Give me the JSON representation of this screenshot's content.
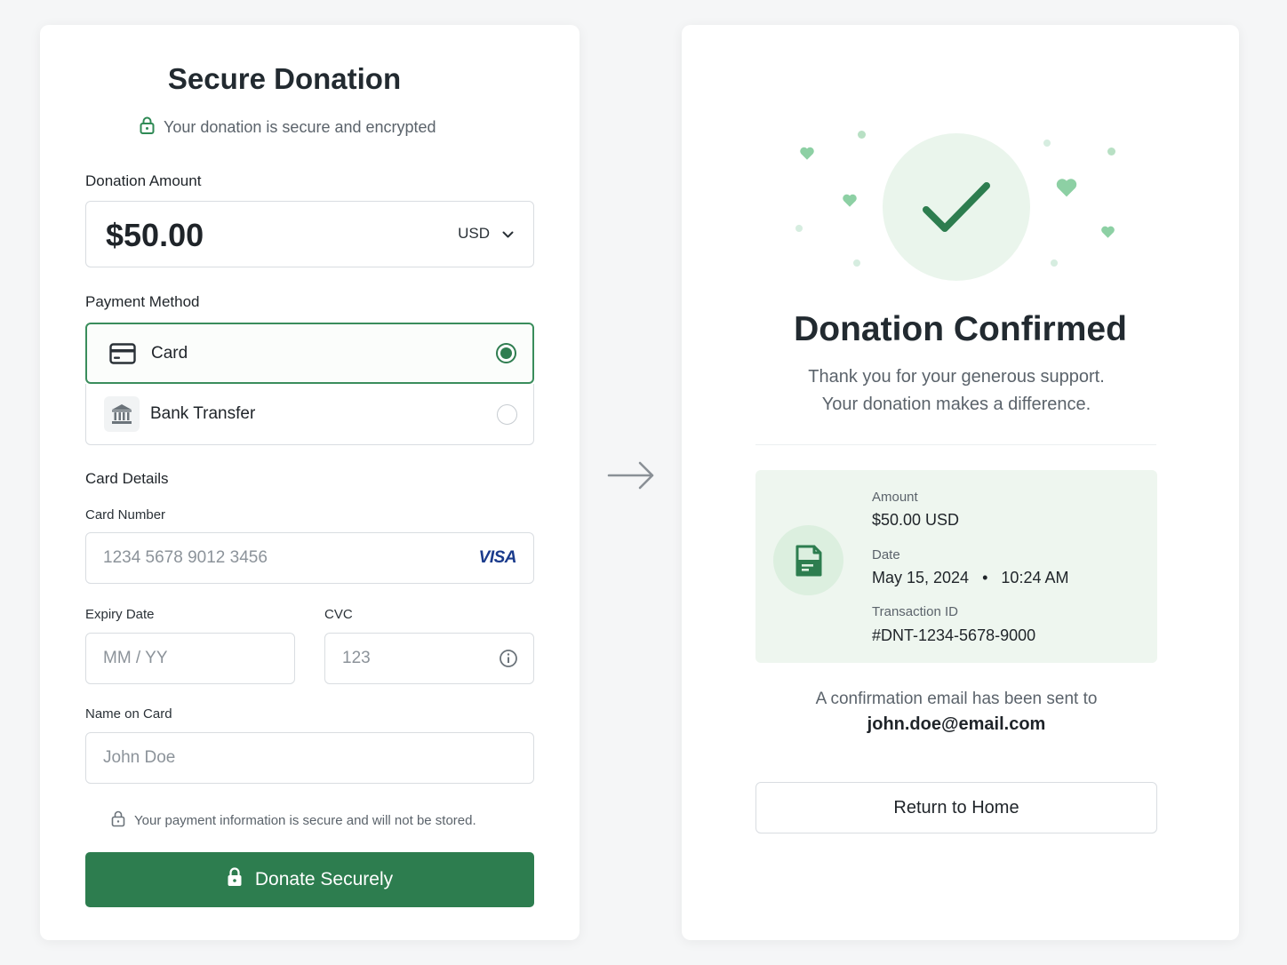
{
  "form": {
    "title": "Secure Donation",
    "subtitle": "Your donation is secure and encrypted",
    "amount_label": "Donation Amount",
    "amount_value": "$50.00",
    "currency": "USD",
    "payment_method_label": "Payment Method",
    "methods": [
      {
        "label": "Card",
        "icon": "credit-card-icon",
        "selected": true
      },
      {
        "label": "Bank Transfer",
        "icon": "bank-icon",
        "selected": false
      }
    ],
    "card_details_label": "Card Details",
    "card_number_label": "Card Number",
    "card_number_placeholder": "1234 5678 9012 3456",
    "card_brand": "VISA",
    "expiry_label": "Expiry Date",
    "expiry_placeholder": "MM / YY",
    "cvc_label": "CVC",
    "cvc_placeholder": "123",
    "name_label": "Name on Card",
    "name_placeholder": "John Doe",
    "security_notice": "Your payment information is secure and will not be stored.",
    "submit_label": "Donate Securely"
  },
  "confirmation": {
    "title": "Donation Confirmed",
    "message_line1": "Thank you for your generous support.",
    "message_line2": "Your donation makes a difference.",
    "amount_key": "Amount",
    "amount_value": "$50.00 USD",
    "date_key": "Date",
    "date_value": "May 15, 2024",
    "time_value": "10:24 AM",
    "txn_key": "Transaction ID",
    "txn_value": "#DNT-1234-5678-9000",
    "email_line": "A confirmation email has been sent to",
    "email": "john.doe@email.com",
    "return_label": "Return to Home"
  },
  "colors": {
    "primary": "#2d7d4f",
    "accent_light": "#eaf5ec",
    "background": "#f5f6f7"
  }
}
